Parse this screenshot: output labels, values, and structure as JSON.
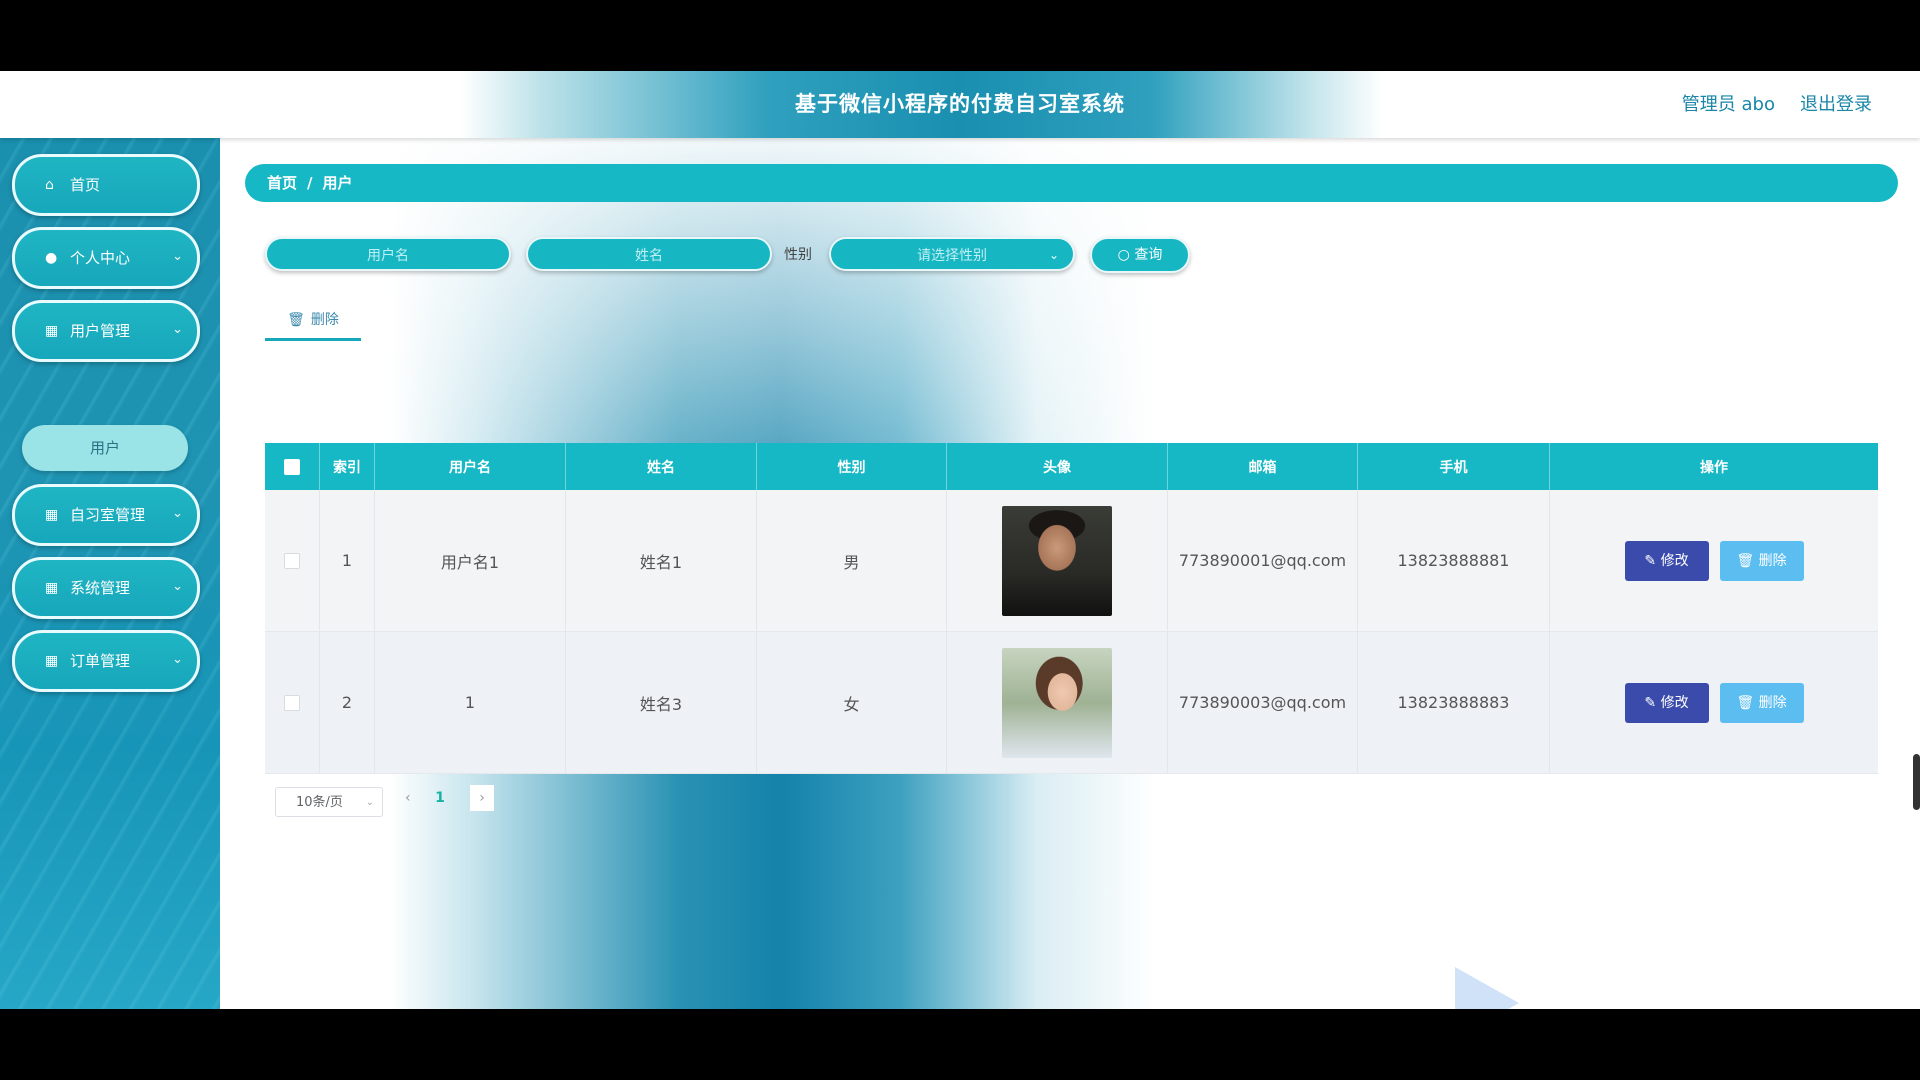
{
  "header": {
    "title": "基于微信小程序的付费自习室系统",
    "admin": "管理员 abo",
    "logout": "退出登录"
  },
  "sidebar": {
    "items": [
      {
        "label": "首页",
        "icon": "home-icon"
      },
      {
        "label": "个人中心",
        "icon": "user-icon"
      },
      {
        "label": "用户管理",
        "icon": "grid-icon"
      },
      {
        "label": "自习室管理",
        "icon": "grid-icon"
      },
      {
        "label": "系统管理",
        "icon": "grid-icon"
      },
      {
        "label": "订单管理",
        "icon": "grid-icon"
      }
    ],
    "sub_item": "用户"
  },
  "breadcrumb": {
    "home": "首页",
    "sep": "/",
    "current": "用户"
  },
  "search": {
    "username_placeholder": "用户名",
    "name_placeholder": "姓名",
    "gender_label": "性别",
    "gender_placeholder": "请选择性别",
    "query_label": "查询"
  },
  "toolbar": {
    "delete_label": "删除"
  },
  "table": {
    "headers": [
      "索引",
      "用户名",
      "姓名",
      "性别",
      "头像",
      "邮箱",
      "手机",
      "操作"
    ],
    "rows": [
      {
        "index": "1",
        "username": "用户名1",
        "name": "姓名1",
        "gender": "男",
        "email": "773890001@qq.com",
        "phone": "13823888881"
      },
      {
        "index": "2",
        "username": "1",
        "name": "姓名3",
        "gender": "女",
        "email": "773890003@qq.com",
        "phone": "13823888883"
      }
    ],
    "edit_label": "修改",
    "delete_label": "删除"
  },
  "pagination": {
    "page_size": "10条/页",
    "current_page": "1"
  },
  "colors": {
    "accent": "#17b8c6",
    "edit": "#3a4bab",
    "delete": "#5bbdf0"
  }
}
